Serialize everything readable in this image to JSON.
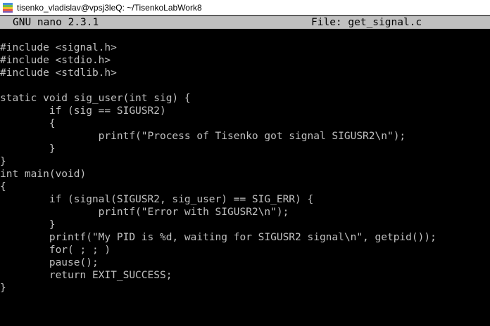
{
  "window": {
    "title": "tisenko_vladislav@vpsj3leQ: ~/TisenkoLabWork8",
    "icon": "putty-terminal-icon"
  },
  "nano": {
    "version": "GNU nano 2.3.1",
    "file_label": "File: get_signal.c"
  },
  "editor": {
    "lines": [
      "#include <signal.h>",
      "#include <stdio.h>",
      "#include <stdlib.h>",
      "",
      "static void sig_user(int sig) {",
      "        if (sig == SIGUSR2)",
      "        {",
      "                printf(\"Process of Tisenko got signal SIGUSR2\\n\");",
      "        }",
      "}",
      "int main(void)",
      "{",
      "        if (signal(SIGUSR2, sig_user) == SIG_ERR) {",
      "                printf(\"Error with SIGUSR2\\n\");",
      "        }",
      "        printf(\"My PID is %d, waiting for SIGUSR2 signal\\n\", getpid());",
      "        for( ; ; )",
      "        pause();",
      "        return EXIT_SUCCESS;",
      "}"
    ]
  },
  "colors": {
    "terminal_bg": "#000000",
    "terminal_fg": "#c0c0c0",
    "header_bg": "#c0c0c0",
    "header_fg": "#000000"
  }
}
